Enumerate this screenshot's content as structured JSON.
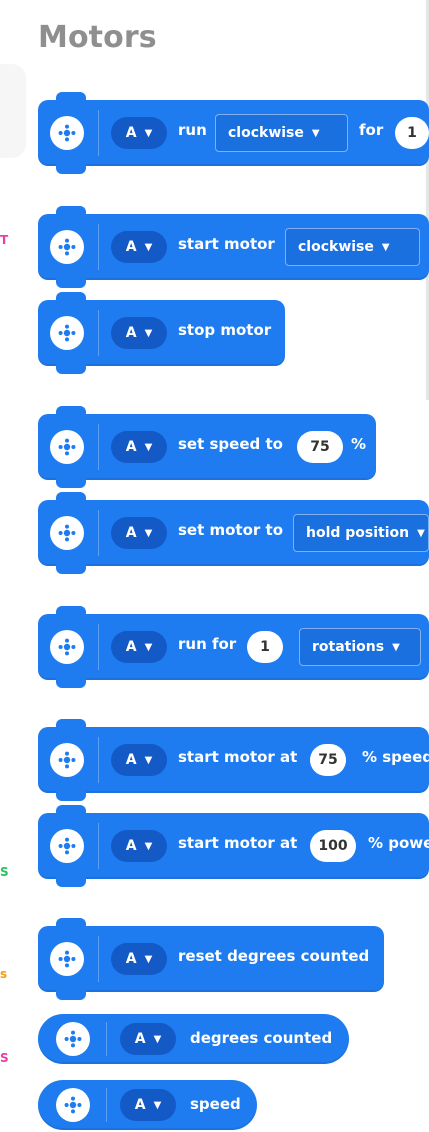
{
  "section_title": "Motors",
  "margin_marks": [
    "T",
    "S",
    "s",
    "S"
  ],
  "colors": {
    "block_blue": "#1f7cf0",
    "port_blue": "#135ac7",
    "title_gray": "#8f8f8f"
  },
  "icons": {
    "motor": "motor-icon",
    "dropdown": "chevron-down-icon"
  },
  "blocks": {
    "run": {
      "port": "A",
      "label_run": "run",
      "direction": "clockwise",
      "label_for": "for",
      "value": "1"
    },
    "start_motor": {
      "port": "A",
      "label": "start motor",
      "direction": "clockwise"
    },
    "stop_motor": {
      "port": "A",
      "label": "stop motor"
    },
    "set_speed": {
      "port": "A",
      "label": "set speed to",
      "value": "75",
      "unit": "%"
    },
    "set_motor_to": {
      "port": "A",
      "label": "set motor to",
      "mode": "hold position"
    },
    "run_for": {
      "port": "A",
      "label": "run for",
      "value": "1",
      "unit": "rotations"
    },
    "start_motor_at_speed": {
      "port": "A",
      "label": "start motor at",
      "value": "75",
      "suffix": "% speed"
    },
    "start_motor_at_power": {
      "port": "A",
      "label": "start motor at",
      "value": "100",
      "suffix": "% power"
    },
    "reset_degrees": {
      "port": "A",
      "label": "reset degrees counted"
    },
    "degrees_counted": {
      "port": "A",
      "label": "degrees counted"
    },
    "speed": {
      "port": "A",
      "label": "speed"
    }
  }
}
